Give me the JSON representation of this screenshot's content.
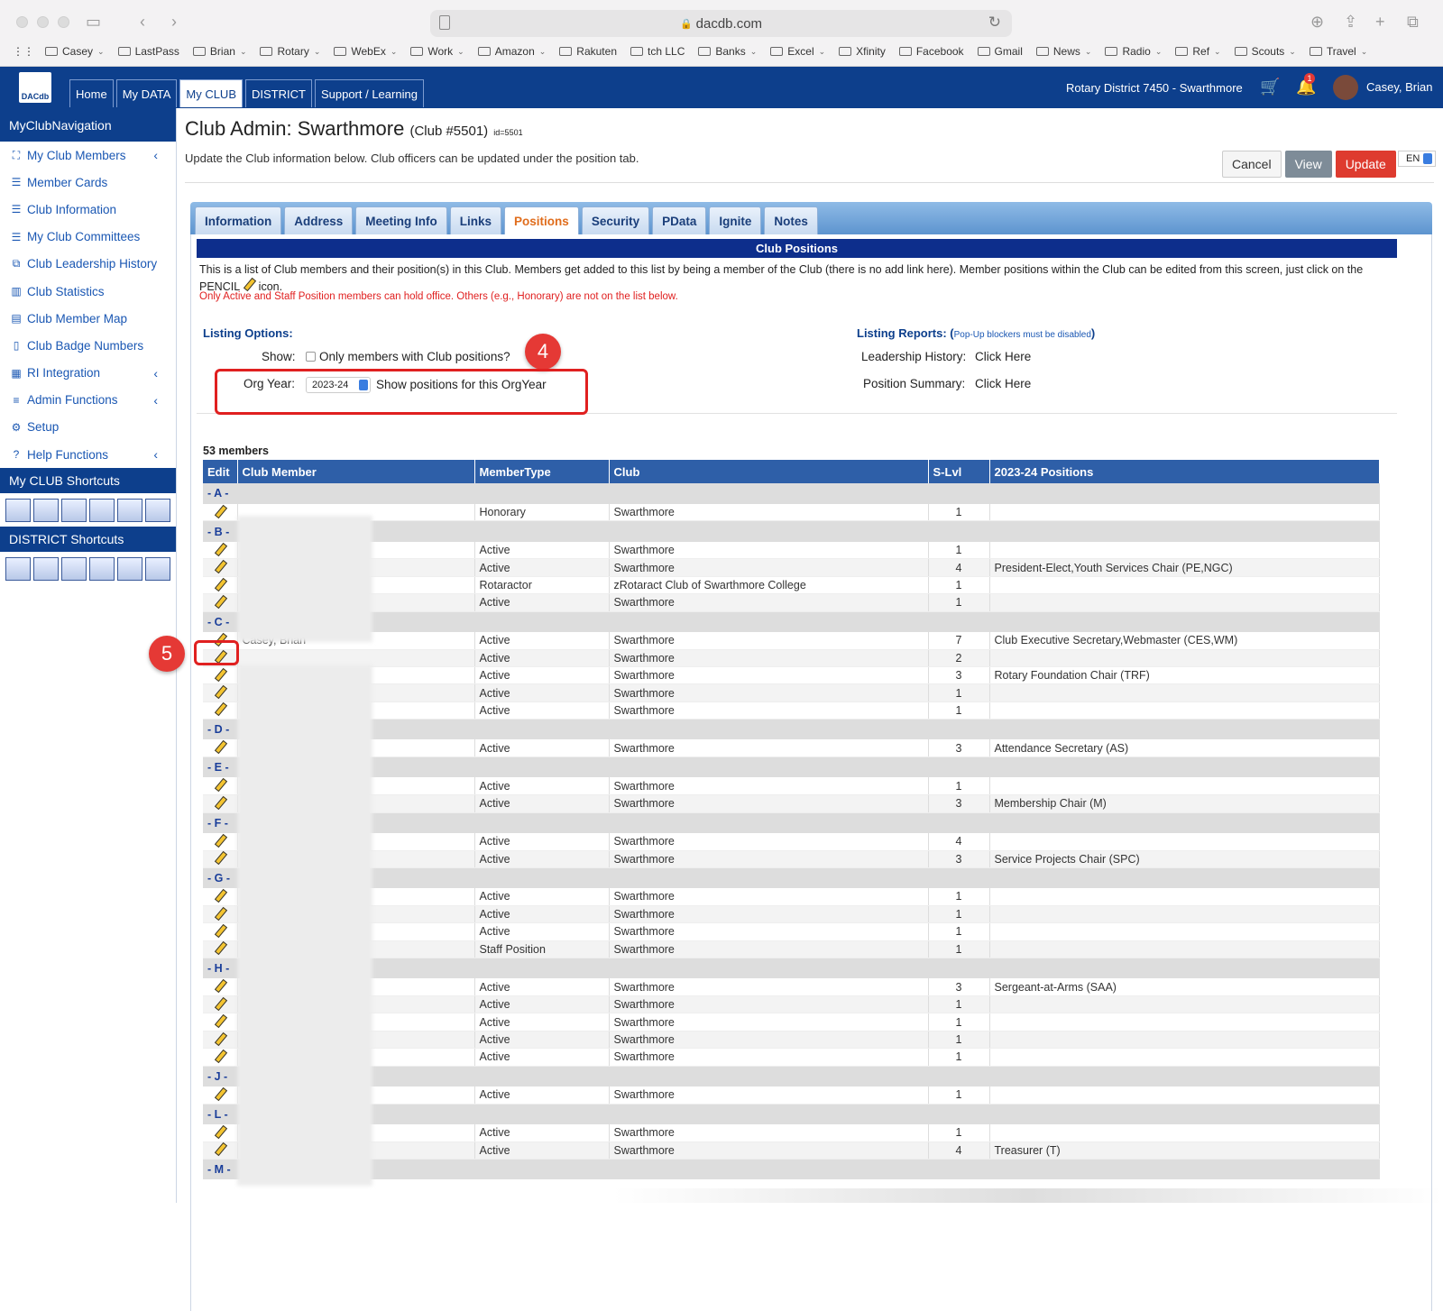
{
  "browser": {
    "url": "dacdb.com",
    "bookmarks": [
      {
        "label": "Casey",
        "chev": true
      },
      {
        "label": "LastPass",
        "chev": false
      },
      {
        "label": "Brian",
        "chev": true
      },
      {
        "label": "Rotary",
        "chev": true
      },
      {
        "label": "WebEx",
        "chev": true
      },
      {
        "label": "Work",
        "chev": true
      },
      {
        "label": "Amazon",
        "chev": true
      },
      {
        "label": "Rakuten",
        "chev": false
      },
      {
        "label": "tch LLC",
        "chev": false
      },
      {
        "label": "Banks",
        "chev": true
      },
      {
        "label": "Excel",
        "chev": true
      },
      {
        "label": "Xfinity",
        "chev": false
      },
      {
        "label": "Facebook",
        "chev": false
      },
      {
        "label": "Gmail",
        "chev": false
      },
      {
        "label": "News",
        "chev": true
      },
      {
        "label": "Radio",
        "chev": true
      },
      {
        "label": "Ref",
        "chev": true
      },
      {
        "label": "Scouts",
        "chev": true
      },
      {
        "label": "Travel",
        "chev": true
      }
    ]
  },
  "topnav": {
    "logo": "DACdb",
    "tabs": [
      "Home",
      "My DATA",
      "My CLUB",
      "DISTRICT",
      "Support / Learning"
    ],
    "active_tab": 2,
    "district": "Rotary District 7450 - Swarthmore",
    "notif_count": "1",
    "user": "Casey, Brian"
  },
  "sidebar": {
    "header": "MyClubNavigation",
    "items": [
      {
        "label": "My Club Members",
        "icon": "members-icon",
        "caret": true
      },
      {
        "label": "Member Cards",
        "icon": "list-icon",
        "caret": false
      },
      {
        "label": "Club Information",
        "icon": "list-icon",
        "caret": false
      },
      {
        "label": "My Club Committees",
        "icon": "list-icon",
        "caret": false
      },
      {
        "label": "Club Leadership History",
        "icon": "history-icon",
        "caret": false
      },
      {
        "label": "Club Statistics",
        "icon": "chart-icon",
        "caret": false
      },
      {
        "label": "Club Member Map",
        "icon": "map-icon",
        "caret": false
      },
      {
        "label": "Club Badge Numbers",
        "icon": "badge-icon",
        "caret": false
      },
      {
        "label": "RI Integration",
        "icon": "integration-icon",
        "caret": true
      },
      {
        "label": "Admin Functions",
        "icon": "menu-icon",
        "caret": true
      },
      {
        "label": "Setup",
        "icon": "gear-icon",
        "caret": false
      },
      {
        "label": "Help Functions",
        "icon": "help-icon",
        "caret": true
      }
    ],
    "club_shortcuts_header": "My CLUB Shortcuts",
    "district_shortcuts_header": "DISTRICT Shortcuts"
  },
  "page": {
    "title": "Club Admin: Swarthmore",
    "club_no": "(Club #5501)",
    "id": "id=5501",
    "intro": "Update the Club information below. Club officers can be updated under the position tab.",
    "buttons": {
      "cancel": "Cancel",
      "view": "View",
      "update": "Update"
    },
    "lang": "EN",
    "tabs": [
      "Information",
      "Address",
      "Meeting Info",
      "Links",
      "Positions",
      "Security",
      "PData",
      "Ignite",
      "Notes"
    ],
    "active_tab": 4
  },
  "positions": {
    "header": "Club Positions",
    "desc": "This is a list of Club members and their position(s) in this Club. Members get added to this list by being a member of the Club (there is no add link here). Member positions within the Club can be edited from this screen, just click on the PENCIL",
    "desc_end": "icon.",
    "red_note": "Only Active and Staff Position members can hold office. Others (e.g., Honorary) are not on the list below.",
    "listing_options": "Listing Options:",
    "show_label": "Show:",
    "show_checkbox": "Only members with Club positions?",
    "orgyear_label": "Org Year:",
    "orgyear_value": "2023-24",
    "orgyear_text": "Show positions for this OrgYear",
    "listing_reports": "Listing Reports: (",
    "popup_note": "Pop-Up blockers must be disabled",
    "listing_reports_end": ")",
    "leadership_history_label": "Leadership History:",
    "leadership_history_link": "Click Here",
    "position_summary_label": "Position Summary:",
    "position_summary_link": "Click Here",
    "count": "53 members",
    "callouts": [
      "4",
      "5"
    ]
  },
  "table": {
    "columns": [
      "Edit",
      "Club Member",
      "MemberType",
      "Club",
      "S-Lvl",
      "2023-24 Positions"
    ],
    "rows": [
      {
        "letter": "- A -"
      },
      {
        "name": "",
        "type": "Honorary",
        "club": "Swarthmore",
        "slvl": "1",
        "pos": ""
      },
      {
        "letter": "- B -"
      },
      {
        "name": "",
        "type": "Active",
        "club": "Swarthmore",
        "slvl": "1",
        "pos": ""
      },
      {
        "name": "",
        "type": "Active",
        "club": "Swarthmore",
        "slvl": "4",
        "pos": "President-Elect,Youth Services Chair (PE,NGC)"
      },
      {
        "name": "",
        "type": "Rotaractor",
        "club": "zRotaract Club of Swarthmore College",
        "slvl": "1",
        "pos": ""
      },
      {
        "name": "",
        "type": "Active",
        "club": "Swarthmore",
        "slvl": "1",
        "pos": ""
      },
      {
        "letter": "- C -"
      },
      {
        "name": "Casey, Brian",
        "type": "Active",
        "club": "Swarthmore",
        "slvl": "7",
        "pos": "Club Executive Secretary,Webmaster (CES,WM)"
      },
      {
        "name": "",
        "type": "Active",
        "club": "Swarthmore",
        "slvl": "2",
        "pos": ""
      },
      {
        "name": "",
        "type": "Active",
        "club": "Swarthmore",
        "slvl": "3",
        "pos": "Rotary Foundation Chair (TRF)"
      },
      {
        "name": "",
        "type": "Active",
        "club": "Swarthmore",
        "slvl": "1",
        "pos": ""
      },
      {
        "name": "",
        "type": "Active",
        "club": "Swarthmore",
        "slvl": "1",
        "pos": ""
      },
      {
        "letter": "- D -"
      },
      {
        "name": "",
        "type": "Active",
        "club": "Swarthmore",
        "slvl": "3",
        "pos": "Attendance Secretary (AS)"
      },
      {
        "letter": "- E -"
      },
      {
        "name": "",
        "type": "Active",
        "club": "Swarthmore",
        "slvl": "1",
        "pos": ""
      },
      {
        "name": "",
        "type": "Active",
        "club": "Swarthmore",
        "slvl": "3",
        "pos": "Membership Chair (M)"
      },
      {
        "letter": "- F -"
      },
      {
        "name": "",
        "type": "Active",
        "club": "Swarthmore",
        "slvl": "4",
        "pos": ""
      },
      {
        "name": "",
        "type": "Active",
        "club": "Swarthmore",
        "slvl": "3",
        "pos": "Service Projects Chair (SPC)"
      },
      {
        "letter": "- G -"
      },
      {
        "name": "",
        "type": "Active",
        "club": "Swarthmore",
        "slvl": "1",
        "pos": ""
      },
      {
        "name": "",
        "type": "Active",
        "club": "Swarthmore",
        "slvl": "1",
        "pos": ""
      },
      {
        "name": "",
        "type": "Active",
        "club": "Swarthmore",
        "slvl": "1",
        "pos": ""
      },
      {
        "name": "",
        "type": "Staff Position",
        "club": "Swarthmore",
        "slvl": "1",
        "pos": ""
      },
      {
        "letter": "- H -"
      },
      {
        "name": "",
        "type": "Active",
        "club": "Swarthmore",
        "slvl": "3",
        "pos": "Sergeant-at-Arms (SAA)"
      },
      {
        "name": "",
        "type": "Active",
        "club": "Swarthmore",
        "slvl": "1",
        "pos": ""
      },
      {
        "name": "",
        "type": "Active",
        "club": "Swarthmore",
        "slvl": "1",
        "pos": ""
      },
      {
        "name": "",
        "type": "Active",
        "club": "Swarthmore",
        "slvl": "1",
        "pos": ""
      },
      {
        "name": "",
        "type": "Active",
        "club": "Swarthmore",
        "slvl": "1",
        "pos": ""
      },
      {
        "letter": "- J -"
      },
      {
        "name": "",
        "type": "Active",
        "club": "Swarthmore",
        "slvl": "1",
        "pos": ""
      },
      {
        "letter": "- L -"
      },
      {
        "name": "",
        "type": "Active",
        "club": "Swarthmore",
        "slvl": "1",
        "pos": ""
      },
      {
        "name": "",
        "type": "Active",
        "club": "Swarthmore",
        "slvl": "4",
        "pos": "Treasurer (T)"
      },
      {
        "letter": "- M -"
      }
    ]
  },
  "colors": {
    "nav": "#0d3f8c",
    "accent": "#e06d1c",
    "update": "#de3b2f",
    "callout": "#e53935"
  }
}
